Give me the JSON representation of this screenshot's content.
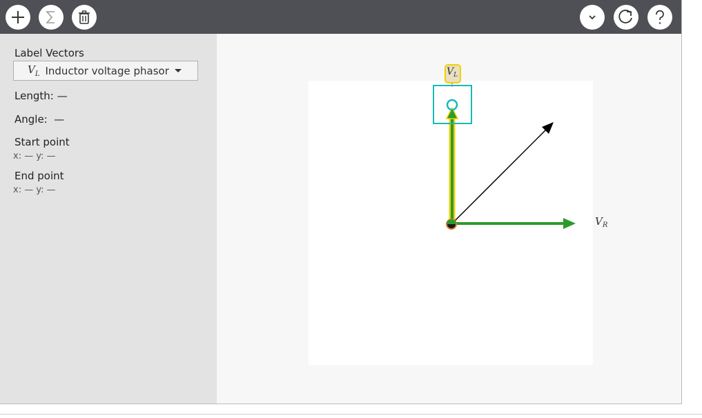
{
  "toolbar": {
    "left_buttons": [
      {
        "name": "add-vector-button",
        "icon": "plus-icon"
      },
      {
        "name": "sum-button",
        "icon": "sigma-icon"
      },
      {
        "name": "delete-button",
        "icon": "trash-icon"
      }
    ],
    "right_buttons": [
      {
        "name": "dropdown-menu-button",
        "icon": "chevron-down-icon"
      },
      {
        "name": "reset-button",
        "icon": "refresh-icon"
      },
      {
        "name": "help-button",
        "icon": "help-icon"
      }
    ]
  },
  "sidebar": {
    "label_vectors_title": "Label Vectors",
    "selected_vector_symbol": "V",
    "selected_vector_subscript": "L",
    "selected_vector_name": "Inductor voltage phasor",
    "length_label": "Length:",
    "length_value": "—",
    "angle_label": "Angle:",
    "angle_value": "—",
    "start_point_label": "Start point",
    "start_point_coords": "x: — y: —",
    "end_point_label": "End point",
    "end_point_coords": "x: — y: —"
  },
  "canvas": {
    "vectors": [
      {
        "label_symbol": "V",
        "label_subscript": "L",
        "color": "#2e9a2e",
        "highlight": "#f1d000",
        "selected": true
      },
      {
        "label_symbol": "V",
        "label_subscript": "R",
        "color": "#2e9a2e"
      },
      {
        "label_symbol": "",
        "label_subscript": "",
        "color": "#000000"
      }
    ],
    "selection_box_color": "#1ab8b8",
    "origin_color": "#e07a30"
  }
}
